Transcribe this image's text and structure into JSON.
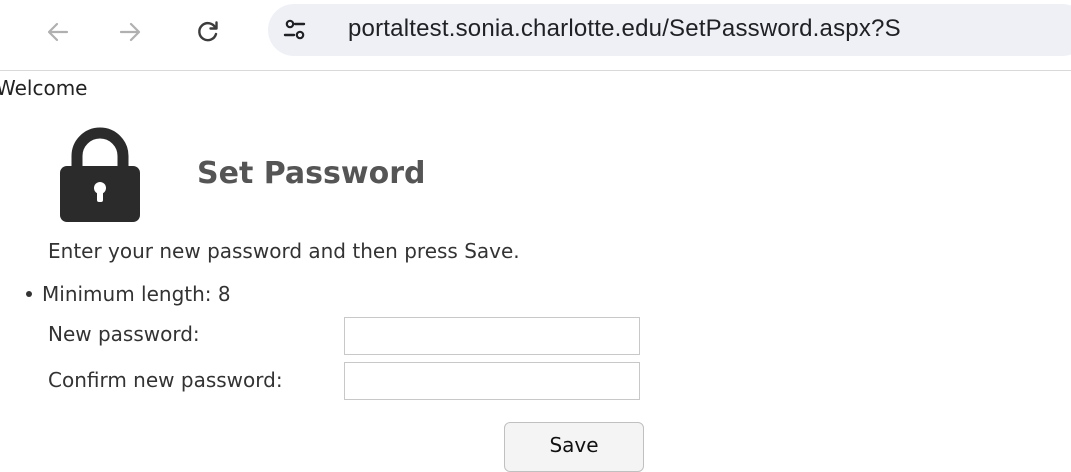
{
  "browser": {
    "url": "portaltest.sonia.charlotte.edu/SetPassword.aspx?S",
    "back_icon": "arrow-left-icon",
    "forward_icon": "arrow-right-icon",
    "reload_icon": "reload-icon",
    "site_info_icon": "tune-icon"
  },
  "header": {
    "welcome": "Welcome"
  },
  "main": {
    "icon": "lock-icon",
    "title": "Set Password",
    "instruction": "Enter your new password and then press Save.",
    "rules": [
      "Minimum length: 8"
    ],
    "fields": {
      "new_password_label": "New password:",
      "new_password_value": "",
      "confirm_password_label": "Confirm new password:",
      "confirm_password_value": ""
    },
    "save_label": "Save"
  },
  "colors": {
    "omnibox_bg": "#eef0f6",
    "title_color": "#555555",
    "lock_color": "#2b2b2b"
  }
}
